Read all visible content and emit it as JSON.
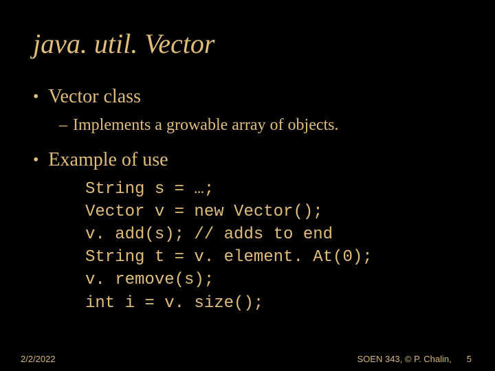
{
  "title": "java. util. Vector",
  "bullets": [
    {
      "text": "Vector class",
      "sub": "Implements a growable array of objects."
    },
    {
      "text": "Example of use",
      "code": [
        "String s = …;",
        "Vector v = new Vector();",
        "v. add(s); // adds to end",
        "String t = v. element. At(0);",
        "v. remove(s);",
        "int i = v. size();"
      ]
    }
  ],
  "footer": {
    "date": "2/2/2022",
    "credit": "SOEN 343, © P. Chalin,",
    "page": "5"
  }
}
